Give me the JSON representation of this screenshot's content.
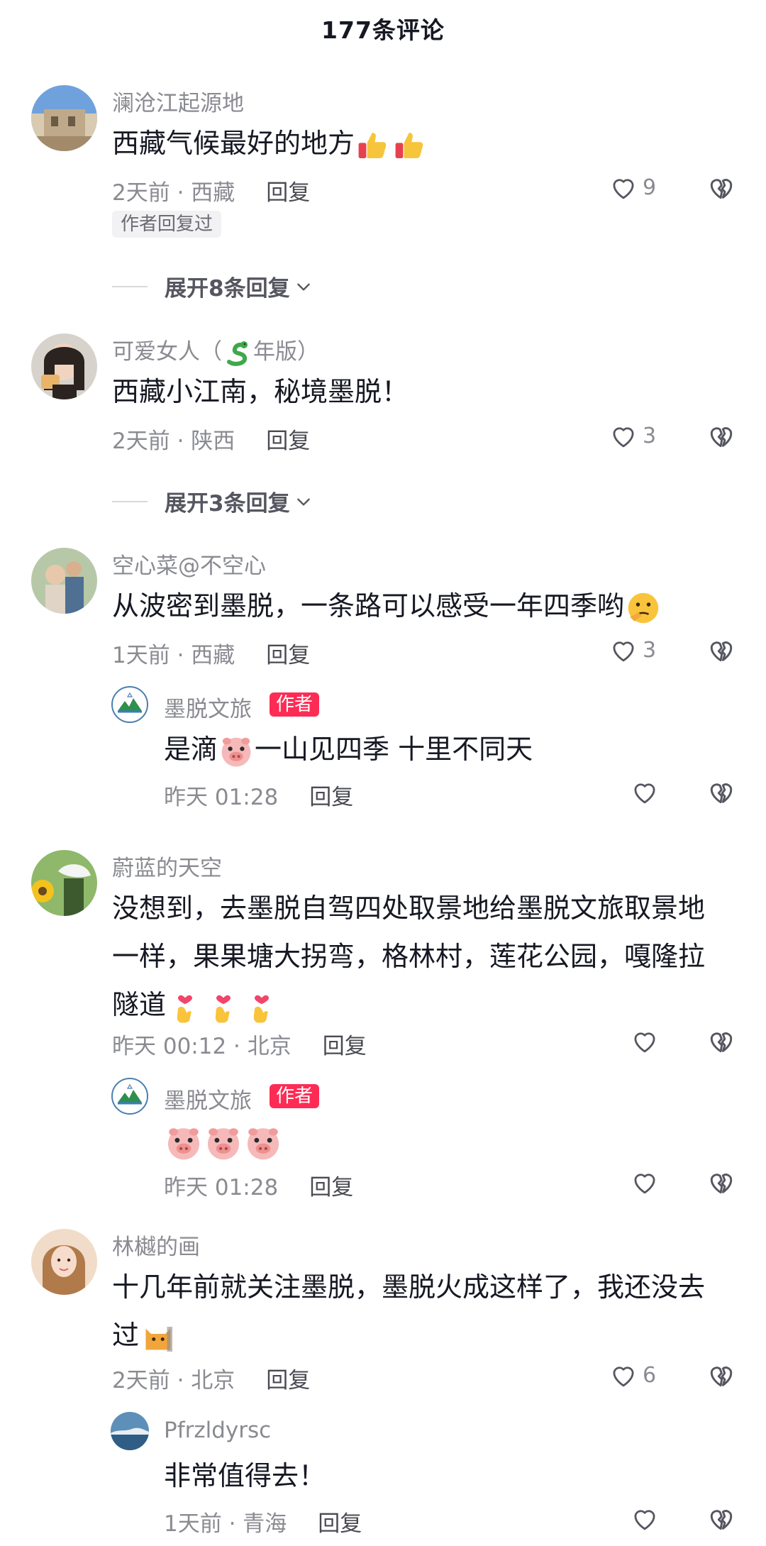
{
  "header": {
    "title": "177条评论"
  },
  "comments": [
    {
      "username": "澜沧江起源地",
      "text": "西藏气候最好的地方",
      "time": "2天前 · 西藏",
      "reply": "回复",
      "likes": "9",
      "tag": "作者回复过",
      "expand": "展开8条回复"
    },
    {
      "username_prefix": "可爱女人（",
      "username_suffix": "年版）",
      "text": "西藏小江南，秘境墨脱！",
      "time": "2天前 · 陕西",
      "reply": "回复",
      "likes": "3",
      "expand": "展开3条回复"
    },
    {
      "username": "空心菜@不空心",
      "text": "从波密到墨脱，一条路可以感受一年四季哟",
      "time": "1天前 · 西藏",
      "reply": "回复",
      "likes": "3",
      "sub_reply": {
        "username": "墨脱文旅",
        "badge": "作者",
        "text_a": "是滴",
        "text_b": "一山见四季 十里不同天",
        "time": "昨天 01:28",
        "reply": "回复"
      }
    },
    {
      "username": "蔚蓝的天空",
      "line1": "没想到，去墨脱自驾四处取景地给墨脱文旅取景地",
      "line2": "一样，果果塘大拐弯，格林村，莲花公园，嘎隆拉",
      "line3": "隧道",
      "time": "昨天 00:12 · 北京",
      "reply": "回复",
      "sub_reply": {
        "username": "墨脱文旅",
        "badge": "作者",
        "time": "昨天 01:28",
        "reply": "回复"
      }
    },
    {
      "username": "林樾的画",
      "line1": "十几年前就关注墨脱，墨脱火成这样了，我还没去",
      "line2": "过",
      "time": "2天前 · 北京",
      "reply": "回复",
      "likes": "6",
      "sub_reply": {
        "username": "Pfrzldyrsc",
        "text": "非常值得去！",
        "time": "1天前 · 青海",
        "reply": "回复"
      }
    }
  ],
  "icons": {
    "like": "heart-outline-icon",
    "dislike": "broken-heart-icon",
    "expand": "chevron-down-icon",
    "emoji_thumbs": "thumbs-up-emoji",
    "emoji_pig": "pig-face-emoji",
    "emoji_heart_hands": "finger-heart-emoji",
    "emoji_think": "thinking-emoji",
    "emoji_cat": "cat-emoji",
    "emoji_snake": "snake-emoji"
  },
  "colors": {
    "accent": "#fe2c55",
    "text": "#161823",
    "muted": "#8a8b91"
  }
}
